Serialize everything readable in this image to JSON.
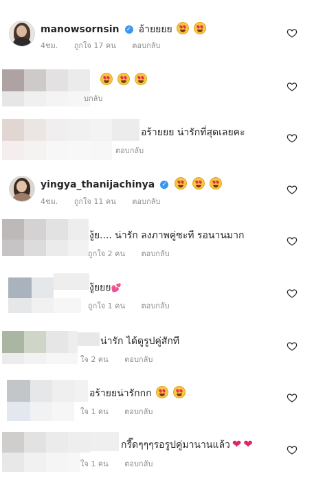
{
  "comments": [
    {
      "username": "manowsornsin",
      "verified": true,
      "text": "อ้ายยยย",
      "time": "4ชม.",
      "likes": "ถูกใจ 17 คน",
      "reply": "ตอบกลับ",
      "emojis": [
        "in-love-face-emoji",
        "heart-eyes-emoji"
      ]
    },
    {
      "username": "",
      "text": "",
      "partial_meta": "บกลับ",
      "emojis": [
        "heart-eyes-emoji",
        "heart-eyes-emoji",
        "heart-eyes-emoji"
      ]
    },
    {
      "username": "",
      "text": "อร้ายยย น่ารักที่สุดเลยคะ",
      "reply": "ตอบกลับ"
    },
    {
      "username": "yingya_thanijachinya",
      "verified": true,
      "time": "4ชม.",
      "likes": "ถูกใจ 11 คน",
      "reply": "ตอบกลับ",
      "emojis": [
        "heart-eyes-emoji",
        "heart-eyes-emoji",
        "heart-eyes-emoji"
      ]
    },
    {
      "username": "",
      "text": "งู้ย.... น่ารัก ลงภาพคู่ซะที รอนานมาก",
      "likes": "ถูกใจ 2 คน",
      "reply": "ตอบกลับ"
    },
    {
      "username": "",
      "text": "งู้ยยย",
      "likes": "ถูกใจ 1 คน",
      "reply": "ตอบกลับ",
      "emojis": [
        "pink-heart-emoji"
      ]
    },
    {
      "username": "",
      "text": "น่ารัก ได้ดูรูปคู่สักที",
      "likes": "ใจ 2 คน",
      "reply": "ตอบกลับ"
    },
    {
      "username": "",
      "text": "อร้ายยน่ารักกก",
      "likes": "ใจ 1 คน",
      "reply": "ตอบกลับ",
      "emojis": [
        "heart-eyes-emoji",
        "heart-eyes-emoji"
      ]
    },
    {
      "username": "",
      "text": "กรี๊ดๆๆๆรอรูปคู่มานานแล้ว",
      "likes": "ใจ 1 คน",
      "reply": "ตอบกลับ",
      "emojis": [
        "red-heart-emoji",
        "red-heart-emoji"
      ]
    }
  ],
  "icons": {
    "like": "heart-outline-icon",
    "verified": "verified-badge-icon"
  },
  "colors": {
    "text": "#262626",
    "meta": "#8e8e8e",
    "verified": "#3897f0",
    "heart": "#e0245e"
  }
}
